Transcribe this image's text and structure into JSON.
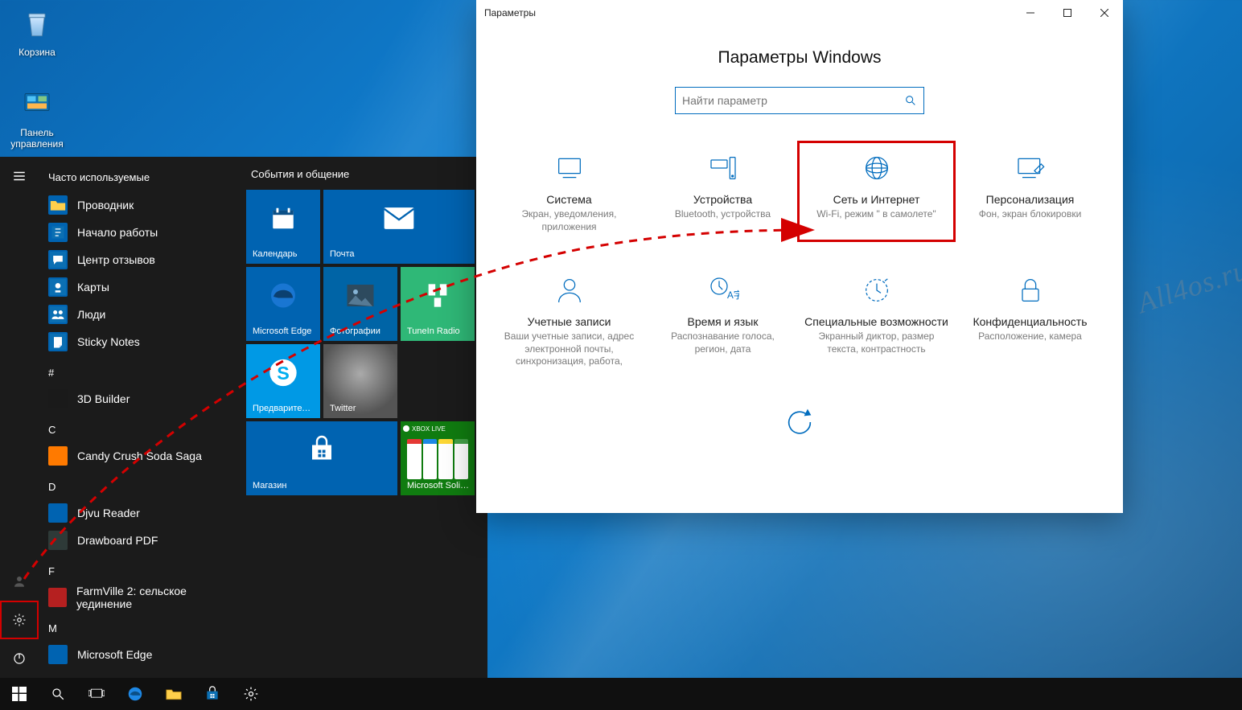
{
  "desktop": {
    "icons": [
      {
        "name": "recycle-bin",
        "label": "Корзина"
      },
      {
        "name": "control-panel",
        "label": "Панель управления"
      }
    ]
  },
  "start_menu": {
    "most_used_title": "Часто используемые",
    "most_used": [
      {
        "label": "Проводник",
        "icon": "folder"
      },
      {
        "label": "Начало работы",
        "icon": "getstarted"
      },
      {
        "label": "Центр отзывов",
        "icon": "feedback"
      },
      {
        "label": "Карты",
        "icon": "maps"
      },
      {
        "label": "Люди",
        "icon": "people"
      },
      {
        "label": "Sticky Notes",
        "icon": "sticky"
      }
    ],
    "groups": [
      {
        "letter": "#",
        "apps": [
          {
            "label": "3D Builder",
            "color": "#1a1a1a"
          }
        ]
      },
      {
        "letter": "C",
        "apps": [
          {
            "label": "Candy Crush Soda Saga",
            "color": "#ff7a00"
          }
        ]
      },
      {
        "letter": "D",
        "apps": [
          {
            "label": "Djvu Reader",
            "color": "#0063B1"
          },
          {
            "label": "Drawboard PDF",
            "color": "#2e3a38"
          }
        ]
      },
      {
        "letter": "F",
        "apps": [
          {
            "label": "FarmVille 2: сельское уединение",
            "color": "#b52020"
          }
        ]
      },
      {
        "letter": "M",
        "apps": [
          {
            "label": "Microsoft Edge",
            "color": "#0063B1"
          }
        ]
      }
    ],
    "tiles_title": "События и общение",
    "tiles": [
      {
        "label": "Календарь",
        "size": "med",
        "color": "#0063B1",
        "icon": "calendar"
      },
      {
        "label": "Почта",
        "size": "wide",
        "color": "#0063B1",
        "icon": "mail"
      },
      {
        "label": "Microsoft Edge",
        "size": "med",
        "color": "#0063B1",
        "icon": "edge"
      },
      {
        "label": "Фотографии",
        "size": "med",
        "color": "#0064a6",
        "icon": "photos"
      },
      {
        "label": "TuneIn Radio",
        "size": "med",
        "color": "#2fb877",
        "icon": "tunein"
      },
      {
        "label": "Предварител…",
        "size": "med",
        "color": "#0099e5",
        "icon": "skype"
      },
      {
        "label": "Twitter",
        "size": "med",
        "color": "#111",
        "icon": "twitter"
      },
      {
        "label": "Магазин",
        "size": "wide",
        "color": "#0063B1",
        "icon": "store"
      },
      {
        "label": "Microsoft Solitaire Collection",
        "size": "med",
        "color": "#107c10",
        "icon": "solitaire",
        "banner": "XBOX LIVE"
      }
    ]
  },
  "settings_window": {
    "titlebar": "Параметры",
    "heading": "Параметры Windows",
    "search_placeholder": "Найти параметр",
    "items": [
      {
        "name": "Система",
        "desc": "Экран, уведомления, приложения",
        "icon": "system"
      },
      {
        "name": "Устройства",
        "desc": "Bluetooth, устройства",
        "icon": "devices"
      },
      {
        "name": "Сеть и Интернет",
        "desc": "Wi-Fi, режим \" в самолете\"",
        "icon": "network",
        "highlight": true
      },
      {
        "name": "Персонализация",
        "desc": "Фон, экран блокировки",
        "icon": "personalize"
      },
      {
        "name": "Учетные записи",
        "desc": "Ваши учетные записи, адрес электронной почты, синхронизация, работа,",
        "icon": "accounts"
      },
      {
        "name": "Время и язык",
        "desc": "Распознавание голоса, регион, дата",
        "icon": "timelang"
      },
      {
        "name": "Специальные возможности",
        "desc": "Экранный диктор, размер текста, контрастность",
        "icon": "ease"
      },
      {
        "name": "Конфиденциальность",
        "desc": "Расположение, камера",
        "icon": "privacy"
      }
    ],
    "partial_icon": "update"
  },
  "watermark": "All4os.ru"
}
